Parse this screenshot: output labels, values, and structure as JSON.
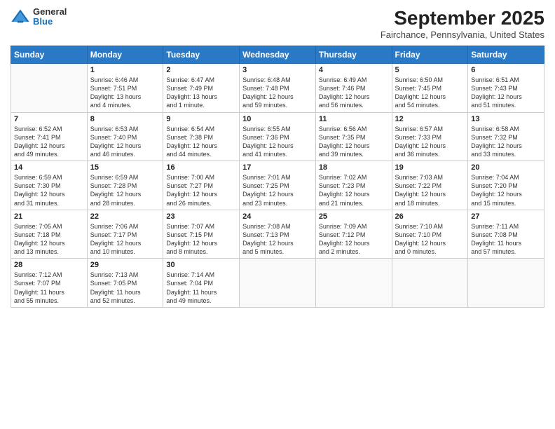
{
  "header": {
    "logo_general": "General",
    "logo_blue": "Blue",
    "title": "September 2025",
    "location": "Fairchance, Pennsylvania, United States"
  },
  "weekdays": [
    "Sunday",
    "Monday",
    "Tuesday",
    "Wednesday",
    "Thursday",
    "Friday",
    "Saturday"
  ],
  "weeks": [
    [
      {
        "day": "",
        "info": ""
      },
      {
        "day": "1",
        "info": "Sunrise: 6:46 AM\nSunset: 7:51 PM\nDaylight: 13 hours\nand 4 minutes."
      },
      {
        "day": "2",
        "info": "Sunrise: 6:47 AM\nSunset: 7:49 PM\nDaylight: 13 hours\nand 1 minute."
      },
      {
        "day": "3",
        "info": "Sunrise: 6:48 AM\nSunset: 7:48 PM\nDaylight: 12 hours\nand 59 minutes."
      },
      {
        "day": "4",
        "info": "Sunrise: 6:49 AM\nSunset: 7:46 PM\nDaylight: 12 hours\nand 56 minutes."
      },
      {
        "day": "5",
        "info": "Sunrise: 6:50 AM\nSunset: 7:45 PM\nDaylight: 12 hours\nand 54 minutes."
      },
      {
        "day": "6",
        "info": "Sunrise: 6:51 AM\nSunset: 7:43 PM\nDaylight: 12 hours\nand 51 minutes."
      }
    ],
    [
      {
        "day": "7",
        "info": "Sunrise: 6:52 AM\nSunset: 7:41 PM\nDaylight: 12 hours\nand 49 minutes."
      },
      {
        "day": "8",
        "info": "Sunrise: 6:53 AM\nSunset: 7:40 PM\nDaylight: 12 hours\nand 46 minutes."
      },
      {
        "day": "9",
        "info": "Sunrise: 6:54 AM\nSunset: 7:38 PM\nDaylight: 12 hours\nand 44 minutes."
      },
      {
        "day": "10",
        "info": "Sunrise: 6:55 AM\nSunset: 7:36 PM\nDaylight: 12 hours\nand 41 minutes."
      },
      {
        "day": "11",
        "info": "Sunrise: 6:56 AM\nSunset: 7:35 PM\nDaylight: 12 hours\nand 39 minutes."
      },
      {
        "day": "12",
        "info": "Sunrise: 6:57 AM\nSunset: 7:33 PM\nDaylight: 12 hours\nand 36 minutes."
      },
      {
        "day": "13",
        "info": "Sunrise: 6:58 AM\nSunset: 7:32 PM\nDaylight: 12 hours\nand 33 minutes."
      }
    ],
    [
      {
        "day": "14",
        "info": "Sunrise: 6:59 AM\nSunset: 7:30 PM\nDaylight: 12 hours\nand 31 minutes."
      },
      {
        "day": "15",
        "info": "Sunrise: 6:59 AM\nSunset: 7:28 PM\nDaylight: 12 hours\nand 28 minutes."
      },
      {
        "day": "16",
        "info": "Sunrise: 7:00 AM\nSunset: 7:27 PM\nDaylight: 12 hours\nand 26 minutes."
      },
      {
        "day": "17",
        "info": "Sunrise: 7:01 AM\nSunset: 7:25 PM\nDaylight: 12 hours\nand 23 minutes."
      },
      {
        "day": "18",
        "info": "Sunrise: 7:02 AM\nSunset: 7:23 PM\nDaylight: 12 hours\nand 21 minutes."
      },
      {
        "day": "19",
        "info": "Sunrise: 7:03 AM\nSunset: 7:22 PM\nDaylight: 12 hours\nand 18 minutes."
      },
      {
        "day": "20",
        "info": "Sunrise: 7:04 AM\nSunset: 7:20 PM\nDaylight: 12 hours\nand 15 minutes."
      }
    ],
    [
      {
        "day": "21",
        "info": "Sunrise: 7:05 AM\nSunset: 7:18 PM\nDaylight: 12 hours\nand 13 minutes."
      },
      {
        "day": "22",
        "info": "Sunrise: 7:06 AM\nSunset: 7:17 PM\nDaylight: 12 hours\nand 10 minutes."
      },
      {
        "day": "23",
        "info": "Sunrise: 7:07 AM\nSunset: 7:15 PM\nDaylight: 12 hours\nand 8 minutes."
      },
      {
        "day": "24",
        "info": "Sunrise: 7:08 AM\nSunset: 7:13 PM\nDaylight: 12 hours\nand 5 minutes."
      },
      {
        "day": "25",
        "info": "Sunrise: 7:09 AM\nSunset: 7:12 PM\nDaylight: 12 hours\nand 2 minutes."
      },
      {
        "day": "26",
        "info": "Sunrise: 7:10 AM\nSunset: 7:10 PM\nDaylight: 12 hours\nand 0 minutes."
      },
      {
        "day": "27",
        "info": "Sunrise: 7:11 AM\nSunset: 7:08 PM\nDaylight: 11 hours\nand 57 minutes."
      }
    ],
    [
      {
        "day": "28",
        "info": "Sunrise: 7:12 AM\nSunset: 7:07 PM\nDaylight: 11 hours\nand 55 minutes."
      },
      {
        "day": "29",
        "info": "Sunrise: 7:13 AM\nSunset: 7:05 PM\nDaylight: 11 hours\nand 52 minutes."
      },
      {
        "day": "30",
        "info": "Sunrise: 7:14 AM\nSunset: 7:04 PM\nDaylight: 11 hours\nand 49 minutes."
      },
      {
        "day": "",
        "info": ""
      },
      {
        "day": "",
        "info": ""
      },
      {
        "day": "",
        "info": ""
      },
      {
        "day": "",
        "info": ""
      }
    ]
  ]
}
